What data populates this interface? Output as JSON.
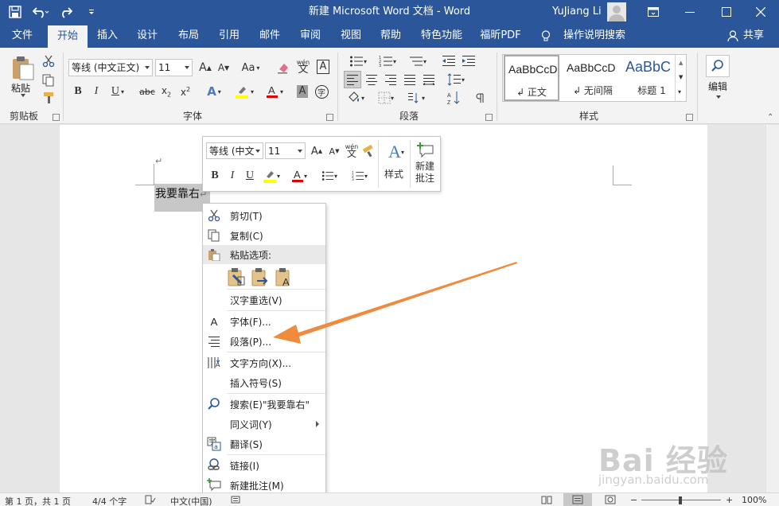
{
  "window": {
    "title": "新建 Microsoft Word 文档  -  Word",
    "user": "YuJiang Li"
  },
  "tabs": [
    "文件",
    "开始",
    "插入",
    "设计",
    "布局",
    "引用",
    "邮件",
    "审阅",
    "视图",
    "帮助",
    "特色功能",
    "福昕PDF"
  ],
  "active_tab": "开始",
  "tell_me": "操作说明搜索",
  "share": "共享",
  "ribbon": {
    "clipboard": {
      "paste": "粘贴",
      "label": "剪贴板"
    },
    "font": {
      "name": "等线 (中文正文)",
      "size": "11",
      "label": "字体",
      "wen": "wén"
    },
    "paragraph": {
      "label": "段落"
    },
    "styles": {
      "label": "样式",
      "items": [
        {
          "sample": "AaBbCcD",
          "name": "↲ 正文"
        },
        {
          "sample": "AaBbCcD",
          "name": "↲ 无间隔"
        },
        {
          "sample": "AaBbC",
          "name": "标题 1"
        }
      ]
    },
    "editing": {
      "label": "编辑"
    }
  },
  "document": {
    "text": "我要靠右",
    "para_mark": "↵"
  },
  "mini_toolbar": {
    "font": "等线 (中文",
    "size": "11",
    "styles": "样式",
    "new_comment": [
      "新建",
      "批注"
    ]
  },
  "context_menu": {
    "items": [
      {
        "label": "剪切(T)",
        "icon": "scissors-icon"
      },
      {
        "label": "复制(C)",
        "icon": "copy-icon"
      },
      {
        "label": "粘贴选项:",
        "icon": "paste-icon"
      },
      {
        "label": "汉字重选(V)",
        "icon": ""
      },
      {
        "label": "字体(F)...",
        "icon": "font-icon"
      },
      {
        "label": "段落(P)...",
        "icon": "paragraph-icon"
      },
      {
        "label": "文字方向(X)...",
        "icon": "text-direction-icon"
      },
      {
        "label": "插入符号(S)",
        "icon": ""
      },
      {
        "label": "搜索(E)\"我要靠右\"",
        "icon": "search-icon"
      },
      {
        "label": "同义词(Y)",
        "icon": ""
      },
      {
        "label": "翻译(S)",
        "icon": "translate-icon"
      },
      {
        "label": "链接(I)",
        "icon": "link-icon"
      },
      {
        "label": "新建批注(M)",
        "icon": "new-comment-icon"
      }
    ]
  },
  "status_bar": {
    "page": "第 1 页，共 1 页",
    "words": "4/4 个字",
    "language": "中文(中国)",
    "zoom": "100%"
  },
  "watermark": {
    "brand": "Bai 经验",
    "url": "jingyan.baidu.com"
  },
  "colors": {
    "accent": "#2b579a",
    "arrow": "#f08a3c",
    "highlight": "#ffff00",
    "font_red": "#e00000"
  }
}
